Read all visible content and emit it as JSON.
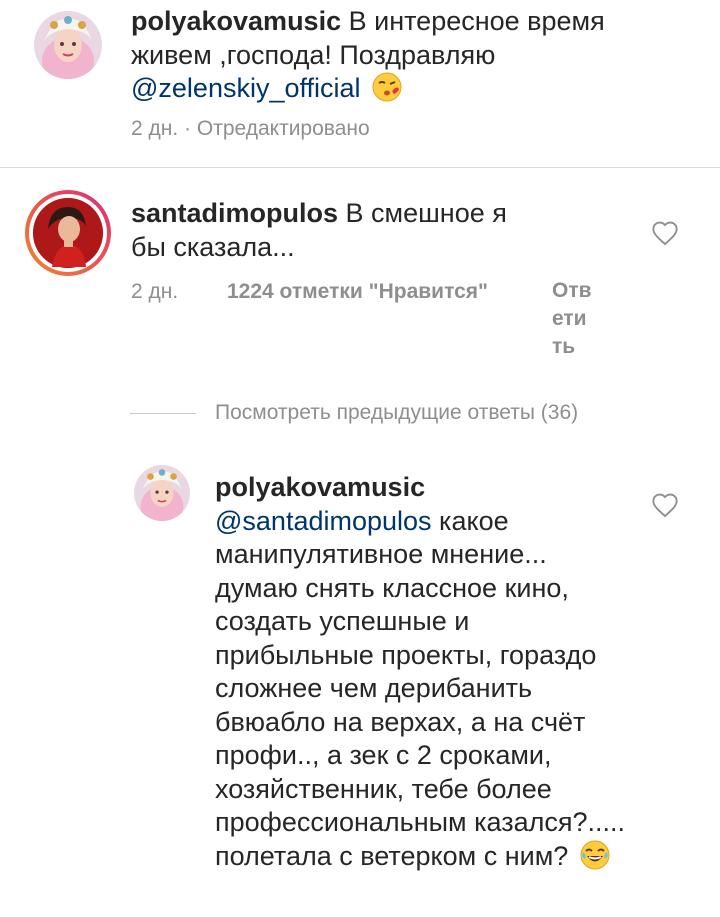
{
  "caption": {
    "username": "polyakovamusic",
    "text_before": "В интересное время живем ,господа! Поздравляю",
    "mention": "@zelenskiy_official",
    "emoji": "kiss-emoji",
    "time": "2 дн.",
    "edited": "Отредактировано"
  },
  "comment": {
    "username": "santadimopulos",
    "text": "В смешное я бы сказала...",
    "time": "2 дн.",
    "likes": "1224 отметки \"Нравится\"",
    "reply_label": "Ответить",
    "story_ring": true
  },
  "view_previous": "Посмотреть предыдущие ответы (36)",
  "reply": {
    "username": "polyakovamusic",
    "mention": "@santadimopulos",
    "text": "какое манипулятивное мнение... думаю снять классное кино, создать успешные и прибыльные проекты, гораздо сложнее чем дерибанить бвюабло на верхах, а на счёт профи.., а зек с 2 сроками, хозяйственник, тебе более профессиональным казался?..... полетала с ветерком с ним?",
    "emoji": "laughing-tears-emoji"
  },
  "colors": {
    "text": "#262626",
    "secondary": "#8e8e8e",
    "mention": "#003569",
    "story_ring_start": "#f58529",
    "story_ring_end": "#dd2a7b"
  },
  "icons": [
    "heart-outline-icon"
  ]
}
